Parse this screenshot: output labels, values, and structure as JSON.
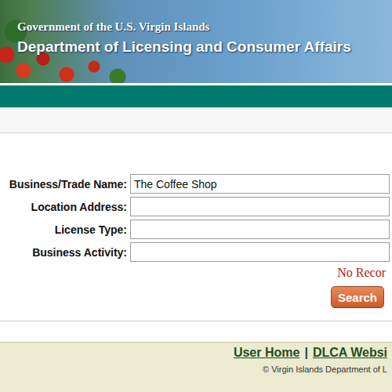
{
  "header": {
    "line1": "Government of the U.S. Virgin Islands",
    "line2": "Department of Licensing and Consumer Affairs"
  },
  "form": {
    "fields": [
      {
        "label": "Business/Trade Name:",
        "value": "The Coffee Shop"
      },
      {
        "label": "Location Address:",
        "value": ""
      },
      {
        "label": "License Type:",
        "value": ""
      },
      {
        "label": "Business Activity:",
        "value": ""
      }
    ],
    "message": "No Recor",
    "button": "Search"
  },
  "footer": {
    "links": [
      "User Home",
      "DLCA Websi"
    ],
    "separator": "|",
    "copyright": "© Virgin Islands Department of L"
  }
}
